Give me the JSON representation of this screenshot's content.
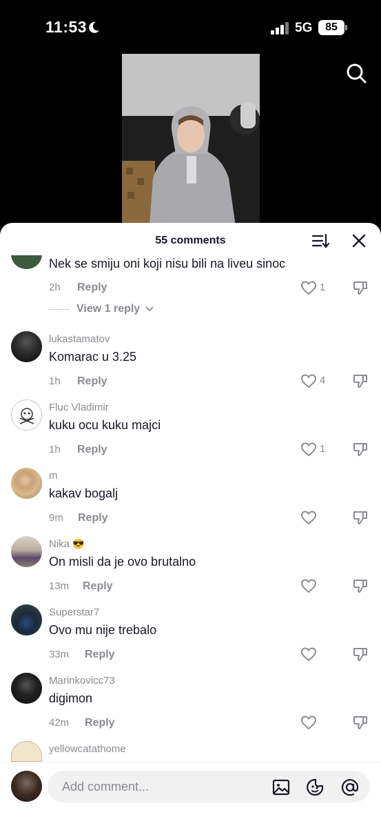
{
  "status_bar": {
    "time": "11:53",
    "network": "5G",
    "battery": "85"
  },
  "comments_sheet": {
    "title": "55 comments"
  },
  "comments": [
    {
      "text": "Nek se smiju oni koji nisu bili na liveu sinoc",
      "time": "2h",
      "reply": "Reply",
      "likes": "1"
    },
    {
      "username": "lukastamatov",
      "text": "Komarac u 3.25",
      "time": "1h",
      "reply": "Reply",
      "likes": "4"
    },
    {
      "username": "Fluc Vladimir",
      "text": "kuku ocu kuku majci",
      "time": "1h",
      "reply": "Reply",
      "likes": "1"
    },
    {
      "username": "m",
      "text": "kakav bogalj",
      "time": "9m",
      "reply": "Reply"
    },
    {
      "username": "Nika",
      "emoji": "😎",
      "text": "On misli da je ovo brutalno",
      "time": "13m",
      "reply": "Reply"
    },
    {
      "username": "Superstar7",
      "text": "Ovo mu nije trebalo",
      "time": "33m",
      "reply": "Reply"
    },
    {
      "username": "Marinkovicc73",
      "text": "digimon",
      "time": "42m",
      "reply": "Reply"
    },
    {
      "username": "yellowcatathome"
    }
  ],
  "view_replies": "View 1 reply",
  "composer": {
    "placeholder": "Add comment..."
  },
  "colors": {
    "text": "#161823",
    "muted": "#8a8b91",
    "input_bg": "#f1f1f2"
  }
}
